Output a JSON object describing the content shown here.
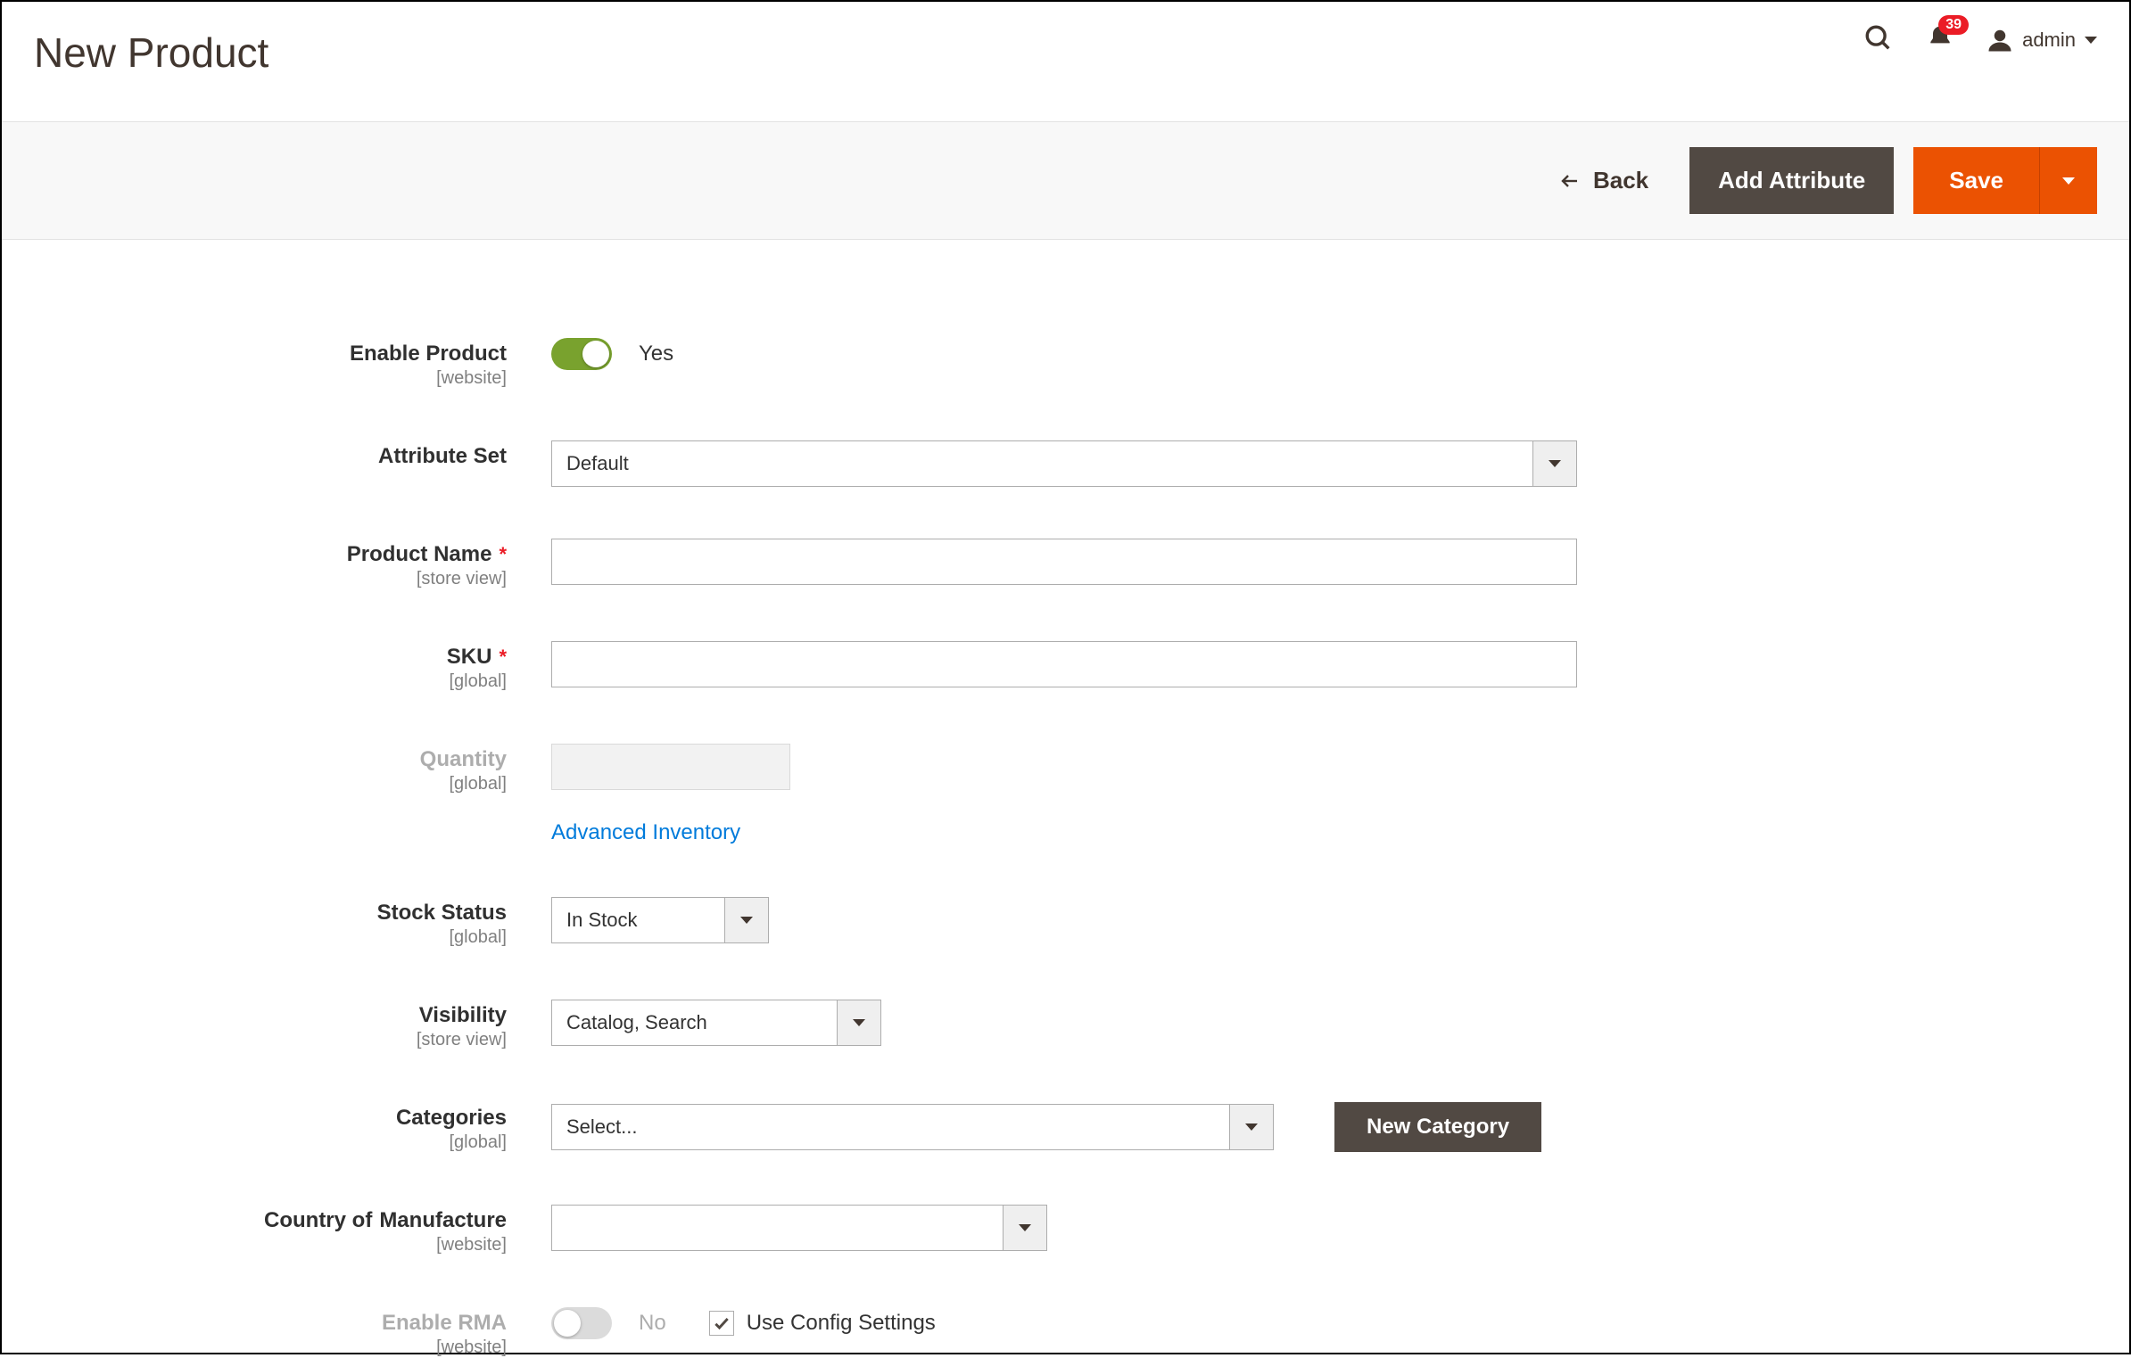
{
  "page_title": "New Product",
  "header": {
    "notification_count": "39",
    "user_name": "admin"
  },
  "actions": {
    "back": "Back",
    "add_attribute": "Add Attribute",
    "save": "Save"
  },
  "form": {
    "enable_product": {
      "label": "Enable Product",
      "scope": "[website]",
      "value_label": "Yes"
    },
    "attribute_set": {
      "label": "Attribute Set",
      "value": "Default"
    },
    "product_name": {
      "label": "Product Name",
      "scope": "[store view]",
      "value": ""
    },
    "sku": {
      "label": "SKU",
      "scope": "[global]",
      "value": ""
    },
    "quantity": {
      "label": "Quantity",
      "scope": "[global]",
      "value": "",
      "advanced_link": "Advanced Inventory"
    },
    "stock_status": {
      "label": "Stock Status",
      "scope": "[global]",
      "value": "In Stock"
    },
    "visibility": {
      "label": "Visibility",
      "scope": "[store view]",
      "value": "Catalog, Search"
    },
    "categories": {
      "label": "Categories",
      "scope": "[global]",
      "value": "Select...",
      "new_button": "New Category"
    },
    "country": {
      "label": "Country of Manufacture",
      "scope": "[website]",
      "value": ""
    },
    "enable_rma": {
      "label": "Enable RMA",
      "scope": "[website]",
      "value_label": "No",
      "use_config_label": "Use Config Settings"
    }
  }
}
